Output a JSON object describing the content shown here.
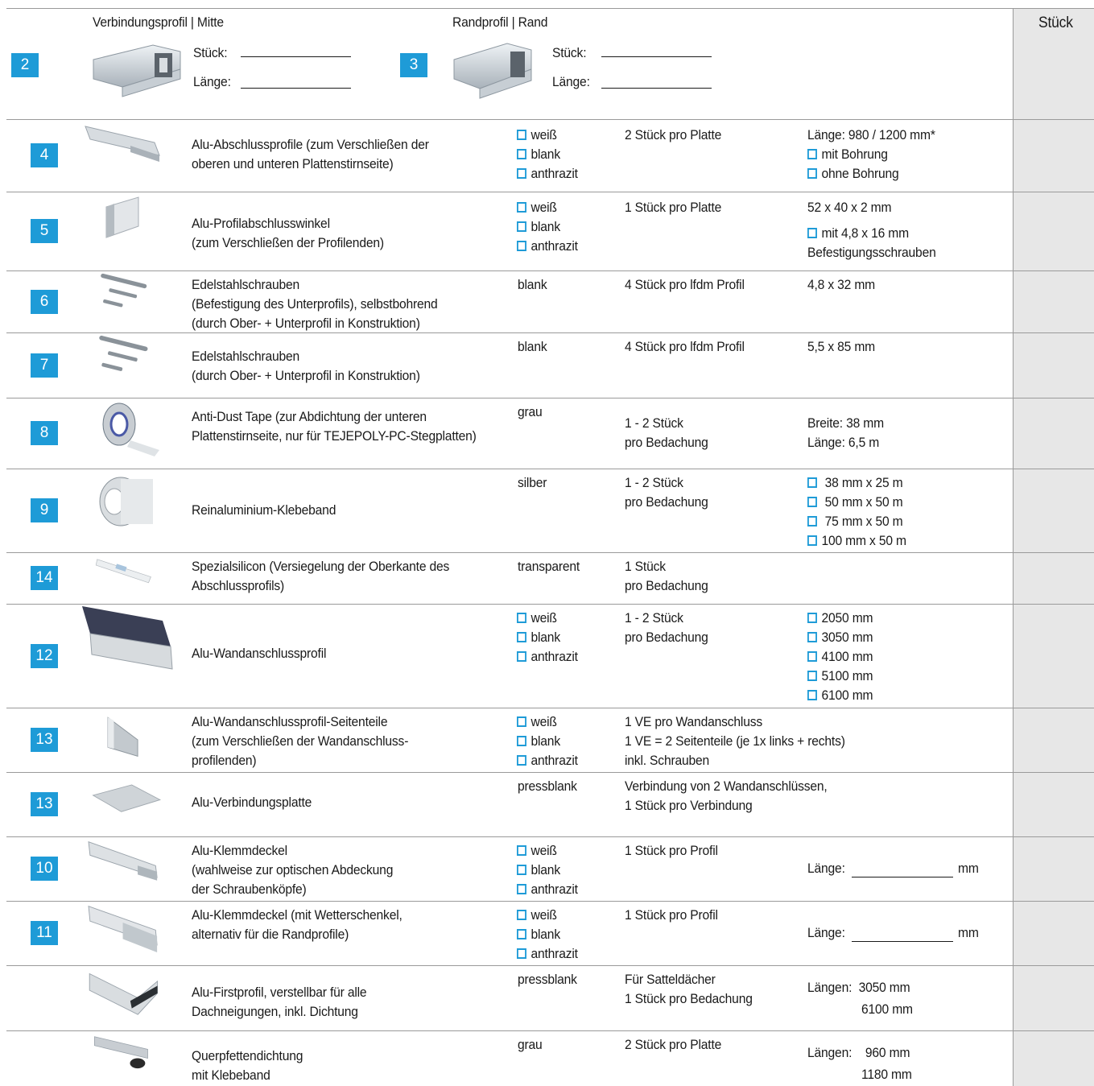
{
  "header": {
    "stueck_col_label": "Stück",
    "item2": {
      "number": "2",
      "title": "Verbindungsprofil | Mitte",
      "stueck_label": "Stück:",
      "laenge_label": "Länge:"
    },
    "item3": {
      "number": "3",
      "title": "Randprofil | Rand",
      "stueck_label": "Stück:",
      "laenge_label": "Länge:"
    }
  },
  "rows": [
    {
      "number": "4",
      "desc": [
        "Alu-Abschlussprofile (zum Verschließen der",
        "oberen und unteren Plattenstirnseite)"
      ],
      "colors": [
        "weiß",
        "blank",
        "anthrazit"
      ],
      "qty": [
        "2 Stück pro Platte"
      ],
      "spec": [
        "Länge: 980 / 1200 mm*"
      ],
      "spec_options": [
        "mit Bohrung",
        "ohne Bohrung"
      ]
    },
    {
      "number": "5",
      "desc": [
        "Alu-Profilabschlusswinkel",
        "(zum Verschließen der Profilenden)"
      ],
      "colors": [
        "weiß",
        "blank",
        "anthrazit"
      ],
      "qty": [
        "1 Stück pro Platte"
      ],
      "spec": [
        "52 x 40 x 2 mm"
      ],
      "spec_options": [
        "mit 4,8 x 16 mm"
      ],
      "spec_extra": "Befestigungsschrauben"
    },
    {
      "number": "6",
      "desc": [
        "Edelstahlschrauben",
        "(Befestigung des Unterprofils), selbstbohrend",
        "(durch Ober- + Unterprofil in Konstruktion)"
      ],
      "color_text": "blank",
      "qty": [
        "4 Stück pro lfdm Profil"
      ],
      "spec": [
        "4,8 x 32 mm"
      ]
    },
    {
      "number": "7",
      "desc": [
        "Edelstahlschrauben",
        "(durch Ober- + Unterprofil in Konstruktion)"
      ],
      "color_text": "blank",
      "qty": [
        "4 Stück pro lfdm Profil"
      ],
      "spec": [
        "5,5 x 85 mm"
      ]
    },
    {
      "number": "8",
      "desc": [
        "Anti-Dust Tape (zur Abdichtung der unteren",
        "Plattenstirnseite, nur für TEJEPOLY-PC-Stegplatten)"
      ],
      "color_text": "grau",
      "qty": [
        "1 - 2 Stück",
        "pro Bedachung"
      ],
      "spec": [
        "Breite: 38 mm",
        "Länge: 6,5 m"
      ]
    },
    {
      "number": "9",
      "desc": [
        "Reinaluminium-Klebeband"
      ],
      "color_text": "silber",
      "qty": [
        "1 - 2 Stück",
        "pro Bedachung"
      ],
      "spec_options": [
        " 38 mm x 25 m",
        " 50 mm x 50 m",
        " 75 mm x 50 m",
        "100 mm x 50 m"
      ]
    },
    {
      "number": "14",
      "desc": [
        "Spezialsilicon (Versiegelung der Oberkante des",
        "Abschlussprofils)"
      ],
      "color_text": "transparent",
      "qty": [
        "1 Stück",
        "pro Bedachung"
      ]
    },
    {
      "number": "12",
      "desc": [
        "Alu-Wandanschlussprofil"
      ],
      "colors": [
        "weiß",
        "blank",
        "anthrazit"
      ],
      "qty": [
        "1 - 2 Stück",
        "pro Bedachung"
      ],
      "spec_options": [
        "2050 mm",
        "3050 mm",
        "4100 mm",
        "5100 mm",
        "6100 mm"
      ]
    },
    {
      "number": "13",
      "desc": [
        "Alu-Wandanschlussprofil-Seitenteile",
        "(zum Verschließen der Wandanschluss-",
        "profilenden)"
      ],
      "colors": [
        "weiß",
        "blank",
        "anthrazit"
      ],
      "qty": [
        "1 VE pro Wandanschluss",
        "1 VE = 2 Seitenteile (je 1x links + rechts)",
        "inkl. Schrauben"
      ]
    },
    {
      "number": "13",
      "desc": [
        "Alu-Verbindungsplatte"
      ],
      "color_text": "pressblank",
      "qty": [
        "Verbindung von 2 Wandanschlüssen,",
        "1 Stück pro Verbindung"
      ]
    },
    {
      "number": "10",
      "desc": [
        "Alu-Klemmdeckel",
        "(wahlweise zur optischen Abdeckung",
        "der Schraubenköpfe)"
      ],
      "colors": [
        "weiß",
        "blank",
        "anthrazit"
      ],
      "qty": [
        "1 Stück pro Profil"
      ],
      "spec_label": "Länge:",
      "spec_unit": "mm"
    },
    {
      "number": "11",
      "desc": [
        "Alu-Klemmdeckel (mit Wetterschenkel,",
        "alternativ für die Randprofile)"
      ],
      "colors": [
        "weiß",
        "blank",
        "anthrazit"
      ],
      "qty": [
        "1 Stück pro Profil"
      ],
      "spec_label": "Länge:",
      "spec_unit": "mm"
    },
    {
      "number": "",
      "desc": [
        "Alu-Firstprofil, verstellbar für alle",
        "Dachneigungen, inkl. Dichtung"
      ],
      "color_text": "pressblank",
      "qty": [
        "Für Satteldächer",
        "1 Stück pro Bedachung"
      ],
      "spec": [
        "Längen:  3050 mm",
        "6100 mm"
      ]
    },
    {
      "number": "",
      "desc": [
        "Querpfettendichtung",
        "mit Klebeband"
      ],
      "color_text": "grau",
      "qty": [
        "2 Stück pro Platte"
      ],
      "spec": [
        "Längen:    960 mm",
        "1180 mm"
      ]
    }
  ],
  "colors": {
    "accent": "#1e9bd7",
    "stueck_column_bg": "#e7e7e7",
    "grid": "#9a9a9a"
  }
}
